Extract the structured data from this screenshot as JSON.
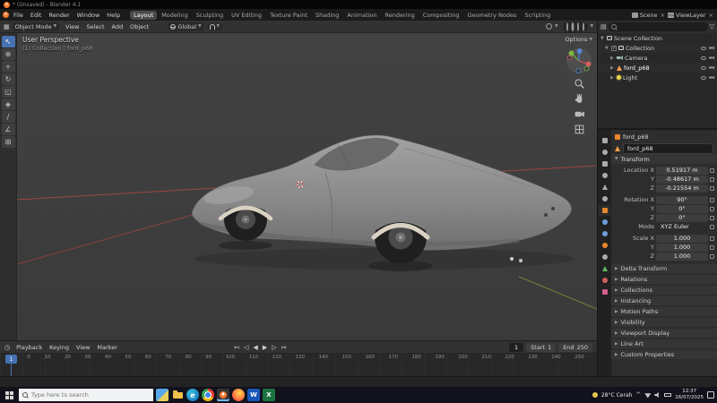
{
  "window": {
    "title": "* (Unsaved) - Blender 4.1"
  },
  "theme": {
    "accent": "#4772b3",
    "blender_orange": "#f5792a"
  },
  "menu_bar": {
    "menus": [
      "File",
      "Edit",
      "Render",
      "Window",
      "Help"
    ],
    "workspaces": [
      "Layout",
      "Modeling",
      "Sculpting",
      "UV Editing",
      "Texture Paint",
      "Shading",
      "Animation",
      "Rendering",
      "Compositing",
      "Geometry Nodes",
      "Scripting"
    ],
    "scene": {
      "label": "Scene"
    },
    "view_layer": {
      "label": "ViewLayer"
    }
  },
  "tool_header": {
    "mode": "Object Mode",
    "menus": [
      "View",
      "Select",
      "Add",
      "Object"
    ],
    "orientation": "Global"
  },
  "viewport": {
    "view_label": "User Perspective",
    "context_label": "(1) Collection | ford_p68",
    "options_label": "Options"
  },
  "outliner": {
    "scene_collection": "Scene Collection",
    "collection": "Collection",
    "items": [
      {
        "label": "Camera"
      },
      {
        "label": "ford_p68"
      },
      {
        "label": "Light"
      }
    ]
  },
  "properties": {
    "breadcrumb_object": "ford_p68",
    "object_name": "ford_p68",
    "transform_title": "Transform",
    "rows": [
      {
        "label": "Location X",
        "value": "0.51917 m"
      },
      {
        "label": "Y",
        "value": "-0.48617 m"
      },
      {
        "label": "Z",
        "value": "-0.21554 m"
      },
      {
        "label": "Rotation X",
        "value": "90°"
      },
      {
        "label": "Y",
        "value": "0°"
      },
      {
        "label": "Z",
        "value": "0°"
      },
      {
        "label": "Mode",
        "value": "XYZ Euler"
      },
      {
        "label": "Scale X",
        "value": "1.000"
      },
      {
        "label": "Y",
        "value": "1.000"
      },
      {
        "label": "Z",
        "value": "1.000"
      }
    ],
    "panels": [
      "Delta Transform",
      "Relations",
      "Collections",
      "Instancing",
      "Motion Paths",
      "Visibility",
      "Viewport Display",
      "Line Art",
      "Custom Properties"
    ]
  },
  "timeline": {
    "menus": [
      "Playback",
      "Keying",
      "View",
      "Marker"
    ],
    "frames": [
      "0",
      "10",
      "20",
      "30",
      "40",
      "50",
      "60",
      "70",
      "80",
      "90",
      "100",
      "110",
      "120",
      "130",
      "140",
      "150",
      "160",
      "170",
      "180",
      "190",
      "200",
      "210",
      "220",
      "230",
      "240",
      "250"
    ],
    "current_frame": "1",
    "start_label": "Start",
    "start_value": "1",
    "end_label": "End",
    "end_value": "250"
  },
  "taskbar": {
    "search_placeholder": "Type here to search",
    "weather": "28°C Cerah",
    "time": "12:37",
    "date": "16/07/2025"
  }
}
